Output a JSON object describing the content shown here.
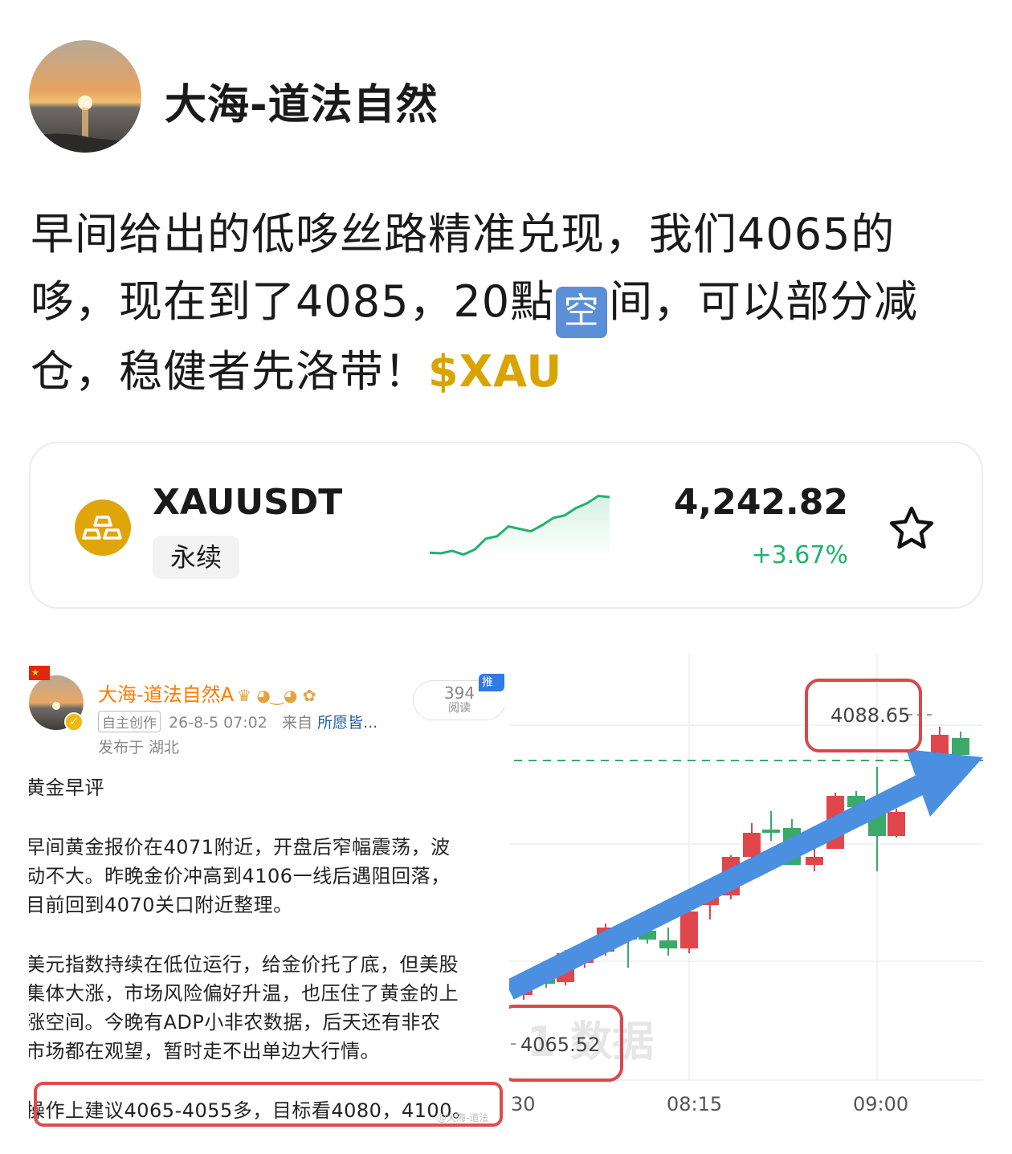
{
  "author": {
    "name": "大海-道法自然"
  },
  "post": {
    "line1": "早间给出的低哆丝路精准兑现，我们4065的",
    "line2_a": "哆，现在到了4085，20點",
    "line2_emoji": "空",
    "line2_b": "间，可以部分减",
    "line3": "仓，稳健者先洛带！",
    "ticker": "$XAU"
  },
  "card": {
    "symbol": "XAUUSDT",
    "contract_type": "永续",
    "price": "4,242.82",
    "change": "+3.67%",
    "sparkline": [
      0.05,
      0.04,
      0.08,
      0.02,
      0.1,
      0.28,
      0.32,
      0.48,
      0.44,
      0.4,
      0.5,
      0.62,
      0.66,
      0.78,
      0.86,
      0.98,
      0.96
    ],
    "colors": {
      "up": "#20b26c",
      "coin": "#e0a50b"
    }
  },
  "screenshot_left": {
    "name": "大海-道法自然A",
    "tag": "自主创作",
    "datetime": "26-8-5 07:02",
    "from_label": "来自",
    "from_source": "所愿皆...",
    "location": "发布于 湖北",
    "reads_count": "394",
    "reads_label": "阅读",
    "promo": "推广",
    "lines": [
      "黄金早评",
      "早间黄金报价在4071附近，开盘后窄幅震荡，波",
      "动不大。昨晚金价冲高到4106一线后遇阻回落，",
      "目前回到4070关口附近整理。",
      "美元指数持续在低位运行，给金价托了底，但美股",
      "集体大涨，市场风险偏好升温，也压住了黄金的上",
      "涨空间。今晚有ADP小非农数据，后天还有非农",
      "市场都在观望，暂时走不出单边大行情。",
      "操作上建议4065-4055多，目标看4080，4100。"
    ],
    "watermark": "@大海-道法"
  },
  "chart": {
    "high_label": "4088.65",
    "low_label": "4065.52",
    "x_ticks": [
      "30",
      "08:15",
      "09:00"
    ],
    "watermark": "1 数据",
    "colors": {
      "up": "#e0474c",
      "down": "#3aaa6a",
      "arrow": "#4a8fe0",
      "box": "#d9484d"
    }
  }
}
